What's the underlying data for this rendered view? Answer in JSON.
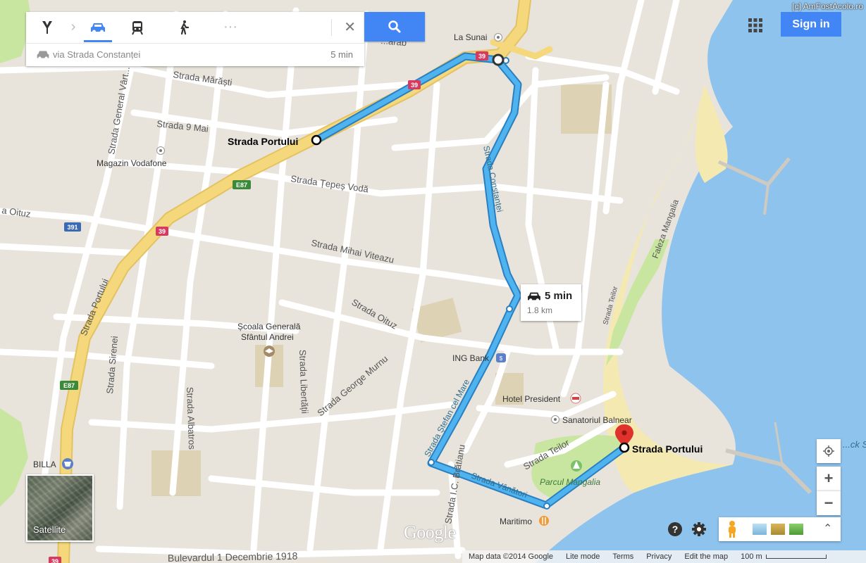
{
  "watermark": "[c] AmFostAcolo.ro",
  "directions": {
    "modes": [
      "directions-icon",
      "car-icon",
      "transit-icon",
      "walk-icon",
      "more-icon"
    ],
    "active_mode": "car",
    "route_via": "via Strada Constanței",
    "route_time": "5 min"
  },
  "header": {
    "sign_in": "Sign in"
  },
  "route_info": {
    "duration": "5 min",
    "distance": "1.8 km"
  },
  "map_labels": {
    "origin": "Strada Portului",
    "destination": "Strada Portului",
    "streets": {
      "marasti": "Strada Mărăști",
      "noua_mai": "Strada 9 Mai",
      "general_varte": "Strada General Vârt...",
      "tepes_voda": "Strada Țepeș Vodă",
      "oituz_left": "a Oituz",
      "mihai_viteazu": "Strada Mihai Viteazu",
      "oituz": "Strada Oituz",
      "constantei": "Strada Constanței",
      "portului": "Strada Portului",
      "sirenei": "Strada Sirenei",
      "albatros": "Strada Albatros",
      "libertatii": "Strada Libertății",
      "george_murnu": "Strada George Murnu",
      "stefan_cel_mare": "Strada Ștefan cel Mare",
      "ic_bratianu": "Strada I.C. Brătianu",
      "vanatori": "Strada Vânători",
      "teilor": "Strada Teilor",
      "teilor2": "Strada Teilor",
      "bulevardul": "Bulevardul 1 Decembrie 1918",
      "faleza": "Faleza Mangalia",
      "sarab": "...arab",
      "black_sea": "...ck Sea"
    },
    "pois": {
      "la_sunai": "La Sunai",
      "vodafone": "Magazin Vodafone",
      "scoala_1": "Școala Generală",
      "scoala_2": "Sfântul Andrei",
      "ing": "ING Bank",
      "hotel": "Hotel President",
      "sanatoriu": "Sanatoriul Balnear",
      "parc": "Parcul Mangalia",
      "maritimo": "Maritimo",
      "billa": "BILLA"
    },
    "road_shields": {
      "r39": "39",
      "e87": "E87",
      "r391": "391"
    }
  },
  "controls": {
    "satellite": "Satellite",
    "zoom_in": "+",
    "zoom_out": "−",
    "logo": "Google"
  },
  "footer": {
    "map_data": "Map data ©2014 Google",
    "lite_mode": "Lite mode",
    "terms": "Terms",
    "privacy": "Privacy",
    "edit": "Edit the map",
    "scale": "100 m"
  },
  "colors": {
    "route": "#4fb3f0",
    "route_outline": "#2a7fc0",
    "water": "#8ec3ee",
    "land": "#e8e4dc",
    "road_major": "#f5d77c",
    "park": "#c8e6a0",
    "beach": "#f4e9b0",
    "accent": "#4285f4",
    "pin": "#e0322c"
  }
}
